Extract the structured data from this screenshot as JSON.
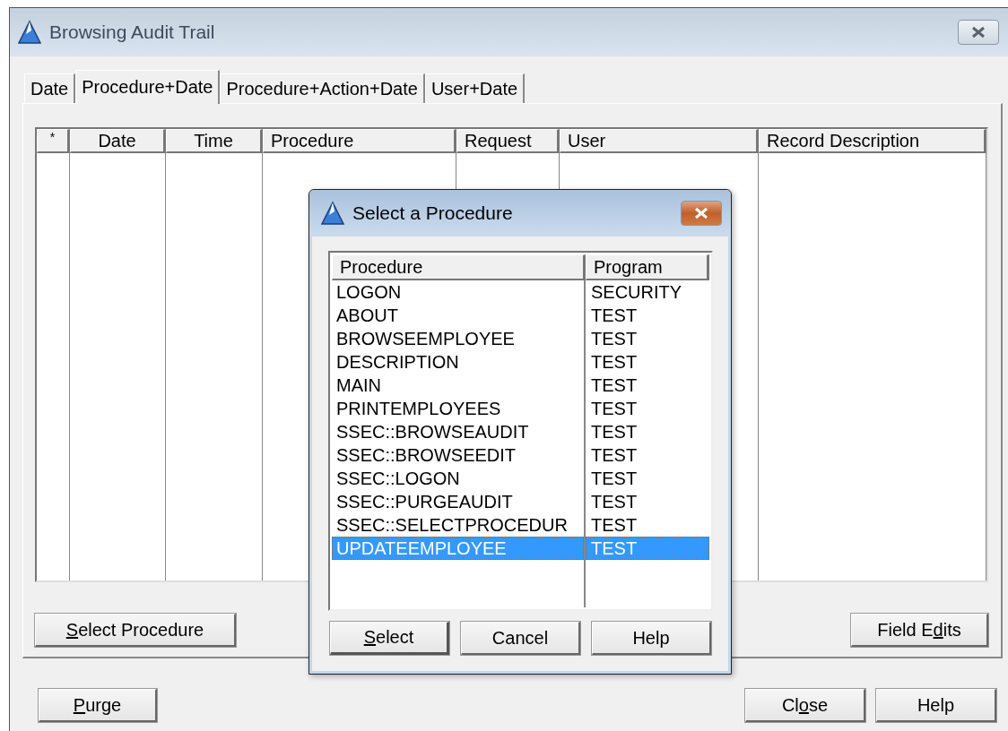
{
  "window": {
    "title": "Browsing Audit Trail"
  },
  "tabs": [
    {
      "label": "Date",
      "selected": false
    },
    {
      "label": "Procedure+Date",
      "selected": true
    },
    {
      "label": "Procedure+Action+Date",
      "selected": false
    },
    {
      "label": "User+Date",
      "selected": false
    }
  ],
  "table": {
    "columns": [
      "*",
      "Date",
      "Time",
      "Procedure",
      "Request",
      "User",
      "Record Description"
    ]
  },
  "panel_buttons": [
    {
      "access_key": "S",
      "after": "elect Procedure"
    },
    {
      "before": "Field E",
      "access_key": "d",
      "after": "its"
    }
  ],
  "footer_buttons": [
    {
      "access_key": "P",
      "after": "urge"
    },
    {
      "before": "Cl",
      "access_key": "o",
      "after": "se"
    },
    {
      "before": "Help"
    }
  ],
  "dialog": {
    "title": "Select a Procedure",
    "columns": [
      "Procedure",
      "Program"
    ],
    "rows": [
      {
        "procedure": "LOGON",
        "program": "SECURITY",
        "selected": false
      },
      {
        "procedure": "ABOUT",
        "program": "TEST",
        "selected": false
      },
      {
        "procedure": "BROWSEEMPLOYEE",
        "program": "TEST",
        "selected": false
      },
      {
        "procedure": "DESCRIPTION",
        "program": "TEST",
        "selected": false
      },
      {
        "procedure": "MAIN",
        "program": "TEST",
        "selected": false
      },
      {
        "procedure": "PRINTEMPLOYEES",
        "program": "TEST",
        "selected": false
      },
      {
        "procedure": "SSEC::BROWSEAUDIT",
        "program": "TEST",
        "selected": false
      },
      {
        "procedure": "SSEC::BROWSEEDIT",
        "program": "TEST",
        "selected": false
      },
      {
        "procedure": "SSEC::LOGON",
        "program": "TEST",
        "selected": false
      },
      {
        "procedure": "SSEC::PURGEAUDIT",
        "program": "TEST",
        "selected": false
      },
      {
        "procedure": "SSEC::SELECTPROCEDUR",
        "program": "TEST",
        "selected": false
      },
      {
        "procedure": "UPDATEEMPLOYEE",
        "program": "TEST",
        "selected": true
      }
    ],
    "buttons": [
      {
        "access_key": "S",
        "after": "elect"
      },
      {
        "before": "Cancel"
      },
      {
        "before": "Help"
      }
    ]
  }
}
